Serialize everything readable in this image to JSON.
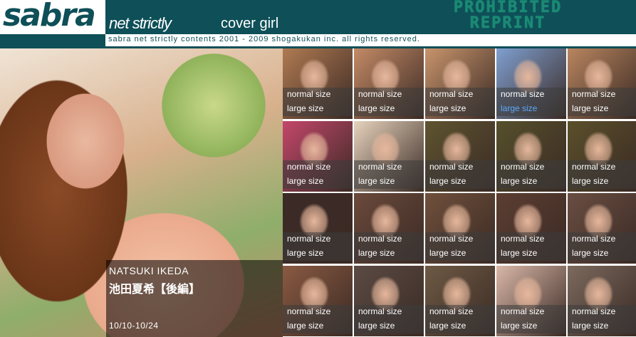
{
  "header": {
    "logo": "sabra",
    "site_name": "net strictly",
    "section": "cover girl",
    "prohibited_line1": "PROHIBITED",
    "prohibited_line2": "REPRINT",
    "copyright": "sabra net strictly contents 2001 - 2009 shogakukan inc. all rights reserved.",
    "brand_color": "#0e4f58",
    "stamp_color": "#1a8a73"
  },
  "feature": {
    "name_en": "NATSUKI IKEDA",
    "name_jp": "池田夏希【後編】",
    "date_range": "10/10-10/24"
  },
  "thumbs": {
    "normal_label": "normal size",
    "large_label": "large size",
    "link_color": "#5aa8ff",
    "colors": [
      [
        "#b07a52",
        "#c48a66",
        "#c8946c",
        "#7f9fd0",
        "#b9855f"
      ],
      [
        "#c4476b",
        "#e7d3bd",
        "#5f5430",
        "#56502c",
        "#5b502b"
      ],
      [
        "#3c2a26",
        "#6b4a3c",
        "#70503c",
        "#5c3e32",
        "#6a4e42"
      ],
      [
        "#8a5a42",
        "#5b4b44",
        "#6e5a44",
        "#d9b7a8",
        "#7c6a5e"
      ]
    ],
    "highlighted": [
      0,
      3
    ]
  }
}
